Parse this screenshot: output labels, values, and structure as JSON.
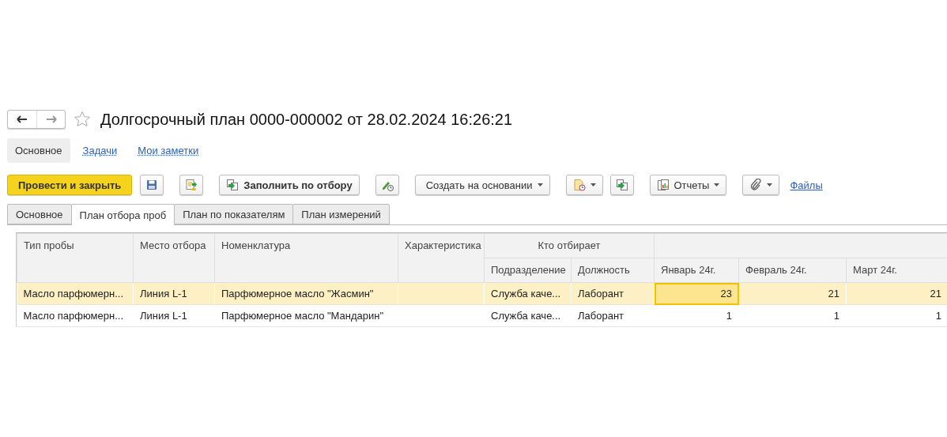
{
  "title": "Долгосрочный план 0000-000002 от 28.02.2024 16:26:21",
  "section_tabs": [
    {
      "label": "Основное",
      "selected": true
    },
    {
      "label": "Задачи",
      "selected": false
    },
    {
      "label": "Мои заметки",
      "selected": false
    }
  ],
  "toolbar": [
    {
      "kind": "primary",
      "label": "Провести и закрыть"
    },
    {
      "kind": "icon"
    },
    {
      "kind": "icon"
    },
    {
      "kind": "labeled",
      "label": "Заполнить по отбору"
    },
    {
      "kind": "icon"
    },
    {
      "kind": "dropdown",
      "label": "Создать на основании"
    },
    {
      "kind": "icon-dropdown"
    },
    {
      "kind": "icon"
    },
    {
      "kind": "labeled-dropdown",
      "label": "Отчеты"
    },
    {
      "kind": "icon-dropdown"
    },
    {
      "kind": "link",
      "label": "Файлы"
    }
  ],
  "tabs": [
    {
      "label": "Основное",
      "selected": false
    },
    {
      "label": "План отбора проб",
      "selected": true
    },
    {
      "label": "План по показателям",
      "selected": false
    },
    {
      "label": "План измерений",
      "selected": false
    }
  ],
  "table": {
    "columns": [
      "Тип пробы",
      "Место отбора",
      "Номенклатура",
      "Характеристика"
    ],
    "group_header": "Кто отбирает",
    "group_columns": [
      "Подразделение",
      "Должность"
    ],
    "month_columns": [
      "Январь 24г.",
      "Февраль 24г.",
      "Март 24г."
    ],
    "rows": [
      {
        "selected": true,
        "cells": [
          "Масло парфюмерн...",
          "Линия L-1",
          "Парфюмерное масло \"Жасмин\"",
          "",
          "Служба каче...",
          "Лаборант"
        ],
        "months": [
          {
            "value": "23",
            "focused": true
          },
          {
            "value": "21",
            "focused": false
          },
          {
            "value": "21",
            "focused": false
          }
        ]
      },
      {
        "selected": false,
        "cells": [
          "Масло парфюмерн...",
          "Линия L-1",
          "Парфюмерное масло \"Мандарин\"",
          "",
          "Служба каче...",
          "Лаборант"
        ],
        "months": [
          {
            "value": "1",
            "focused": false
          },
          {
            "value": "1",
            "focused": false
          },
          {
            "value": "1",
            "focused": false
          }
        ]
      }
    ]
  }
}
